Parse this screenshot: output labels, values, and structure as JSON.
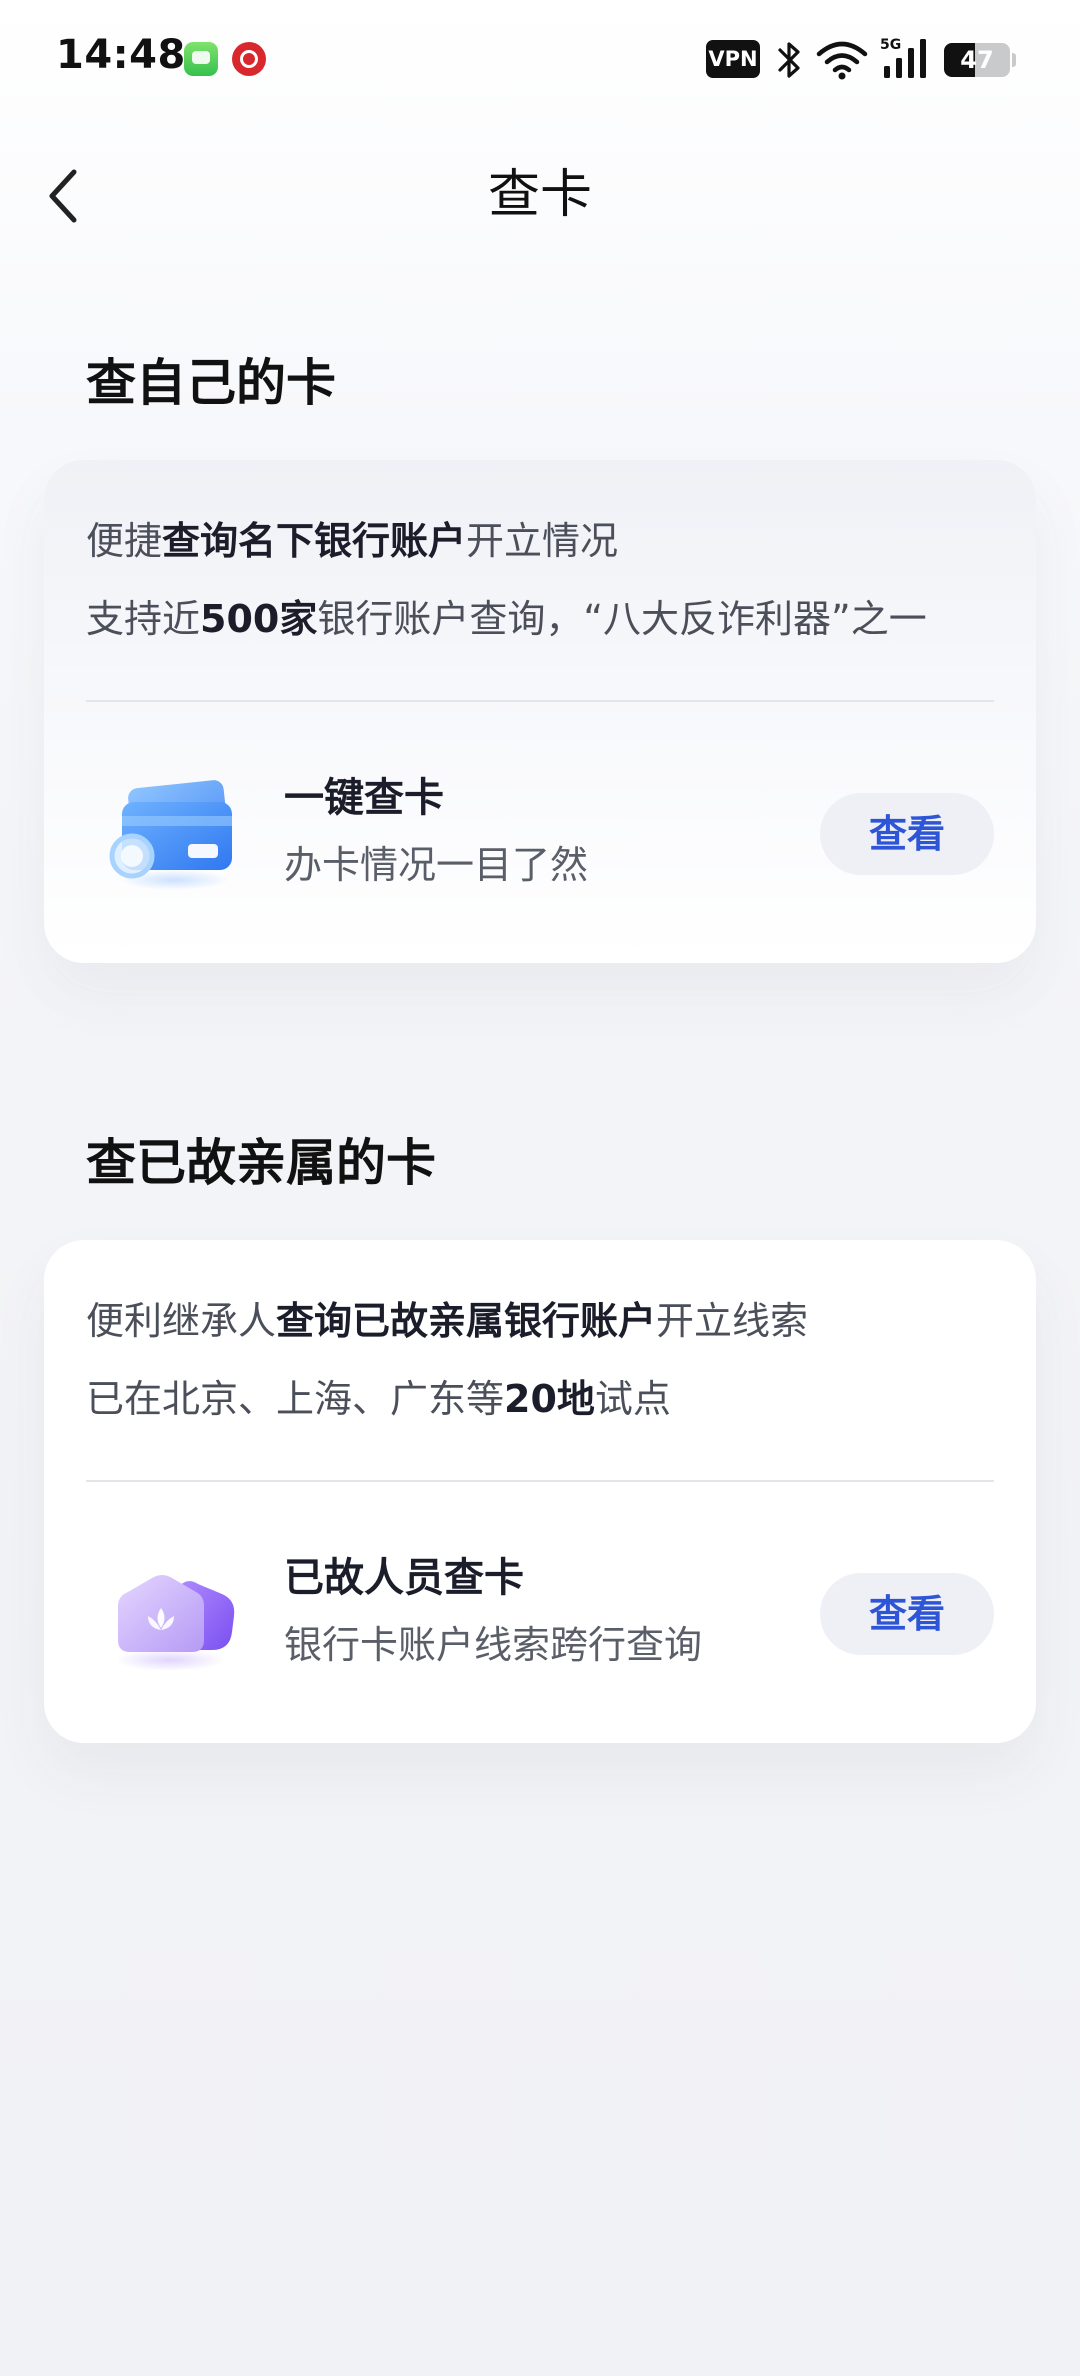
{
  "status_bar": {
    "time": "14:48",
    "vpn_label": "VPN",
    "network_label": "5G",
    "battery_level": "47",
    "battery_fraction": 0.47,
    "icons": [
      "messages-app-icon",
      "bank-app-icon",
      "vpn-icon",
      "bluetooth-icon",
      "wifi-icon",
      "cellular-signal-icon",
      "battery-icon"
    ]
  },
  "nav": {
    "back_icon": "chevron-left-icon",
    "title": "查卡"
  },
  "sections": [
    {
      "heading": "查自己的卡",
      "line1": {
        "pre": "便捷",
        "bold": "查询名下银行账户",
        "post": "开立情况"
      },
      "line2": {
        "pre": "支持近",
        "bold": "500家",
        "post": "银行账户查询，“八大反诈利器”之一"
      },
      "feature": {
        "icon": "bank-card-search-icon",
        "title": "一键查卡",
        "subtitle": "办卡情况一目了然",
        "button_label": "查看"
      }
    },
    {
      "heading": "查已故亲属的卡",
      "line1": {
        "pre": "便利继承人",
        "bold": "查询已故亲属银行账户",
        "post": "开立线索"
      },
      "line2": {
        "pre": "已在北京、上海、广东等",
        "bold": "20地",
        "post": "试点"
      },
      "feature": {
        "icon": "lotus-card-icon",
        "title": "已故人员查卡",
        "subtitle": "银行卡账户线索跨行查询",
        "button_label": "查看"
      }
    }
  ],
  "colors": {
    "accent": "#2e55d6",
    "button_bg": "#eef0f6",
    "text_primary": "#1b1e2a",
    "text_secondary": "#4b4f5a"
  }
}
